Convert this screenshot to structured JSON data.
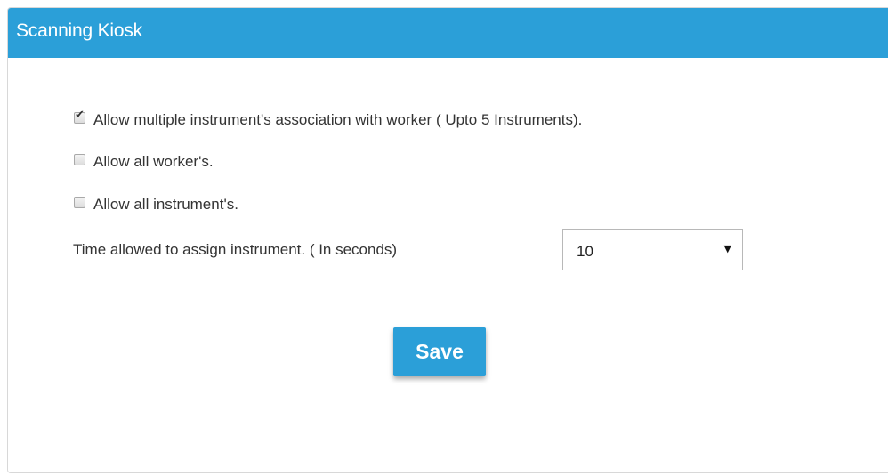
{
  "panel": {
    "title": "Scanning Kiosk",
    "accent_color": "#2b9fd8"
  },
  "options": [
    {
      "label": "Allow multiple instrument's association with worker ( Upto 5 Instruments).",
      "checked": true
    },
    {
      "label": "Allow all worker's.",
      "checked": false
    },
    {
      "label": "Allow all instrument's.",
      "checked": false
    }
  ],
  "time_setting": {
    "label": "Time allowed to assign instrument. ( In seconds)",
    "selected_value": "10",
    "arrow_icon": "caret-down-icon"
  },
  "save_label": "Save",
  "icons": {
    "check": "check-icon"
  }
}
